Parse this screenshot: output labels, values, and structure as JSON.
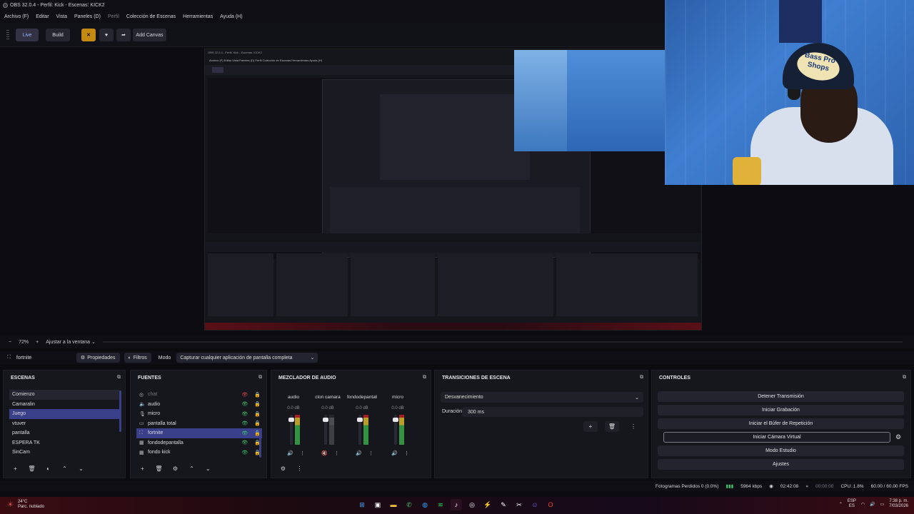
{
  "window": {
    "title": "OBS 32.0.4 - Perfil: Kick - Escenas: KICK2"
  },
  "menu": [
    "Archivo (F)",
    "Editar",
    "Vista",
    "Paneles (D)",
    "Perfil",
    "Colección de Escenas",
    "Herramientas",
    "Ayuda (H)"
  ],
  "toolbar": {
    "live": "Live",
    "build": "Build",
    "add_canvas": "Add Canvas"
  },
  "preview": {
    "zoom": "72%",
    "zoom_minus": "−",
    "zoom_plus": "+",
    "fit": "Ajustar a la ventana",
    "webcam_cap_text": "Bass Pro Shops"
  },
  "source_bar": {
    "name": "fortnite",
    "properties": "Propiedades",
    "filters": "Filtros",
    "mode_label": "Modo",
    "mode_value": "Capturar cualquier aplicación de pantalla completa"
  },
  "scenes": {
    "title": "ESCENAS",
    "items": [
      "Comienzo",
      "Camaralin",
      "Juego",
      "vtuver",
      "pantalla",
      "ESPERA TK",
      "SinCam"
    ],
    "selected": "Juego"
  },
  "sources": {
    "title": "FUENTES",
    "items": [
      {
        "name": "chat",
        "icon": "chat-icon",
        "visible": false
      },
      {
        "name": "audio",
        "icon": "speaker-icon",
        "visible": true
      },
      {
        "name": "micro",
        "icon": "mic-icon",
        "visible": true
      },
      {
        "name": "pantalla total",
        "icon": "monitor-icon",
        "visible": true
      },
      {
        "name": "fortnite",
        "icon": "game-icon",
        "visible": true
      },
      {
        "name": "fondodepantalla",
        "icon": "image-icon",
        "visible": true
      },
      {
        "name": "fondo kick",
        "icon": "image-icon",
        "visible": true
      }
    ],
    "selected": "fortnite"
  },
  "mixer": {
    "title": "MEZCLADOR DE AUDIO",
    "channels": [
      {
        "name": "audio",
        "db": "0.0 dB",
        "muted": false
      },
      {
        "name": "clon camara",
        "db": "0.0 dB",
        "muted": true
      },
      {
        "name": "fondodepantall",
        "db": "0.0 dB",
        "muted": false
      },
      {
        "name": "micro",
        "db": "0.0 dB",
        "muted": false
      }
    ]
  },
  "transitions": {
    "title": "TRANSICIONES DE ESCENA",
    "selected": "Desvanecimiento",
    "duration_label": "Duración",
    "duration_value": "300 ms"
  },
  "controls": {
    "title": "CONTROLES",
    "buttons": [
      "Detener Transmisión",
      "Iniciar Grabación",
      "Iniciar el Búfer de Repetición",
      "Iniciar Cámara Virtual",
      "Modo Estudio",
      "Ajustes"
    ]
  },
  "status": {
    "dropped": "Fotogramas Perdidos 0 (0.0%)",
    "bitrate": "5964 kbps",
    "stream_time": "02:42:08",
    "rec_time": "00:00:00",
    "cpu": "CPU: 1.8%",
    "fps": "60.00 / 60.00 FPS"
  },
  "taskbar": {
    "temp": "24°C",
    "weather": "Parc. nublado",
    "lang_top": "ESP",
    "lang_bottom": "ES",
    "time": "7:38 p. m.",
    "date": "7/03/2026"
  },
  "colors": {
    "accent": "#3a3f8a",
    "live_green": "#3ec26a",
    "canvas_yellow": "#c58a12",
    "taskbar_red": "#3a0c12"
  }
}
